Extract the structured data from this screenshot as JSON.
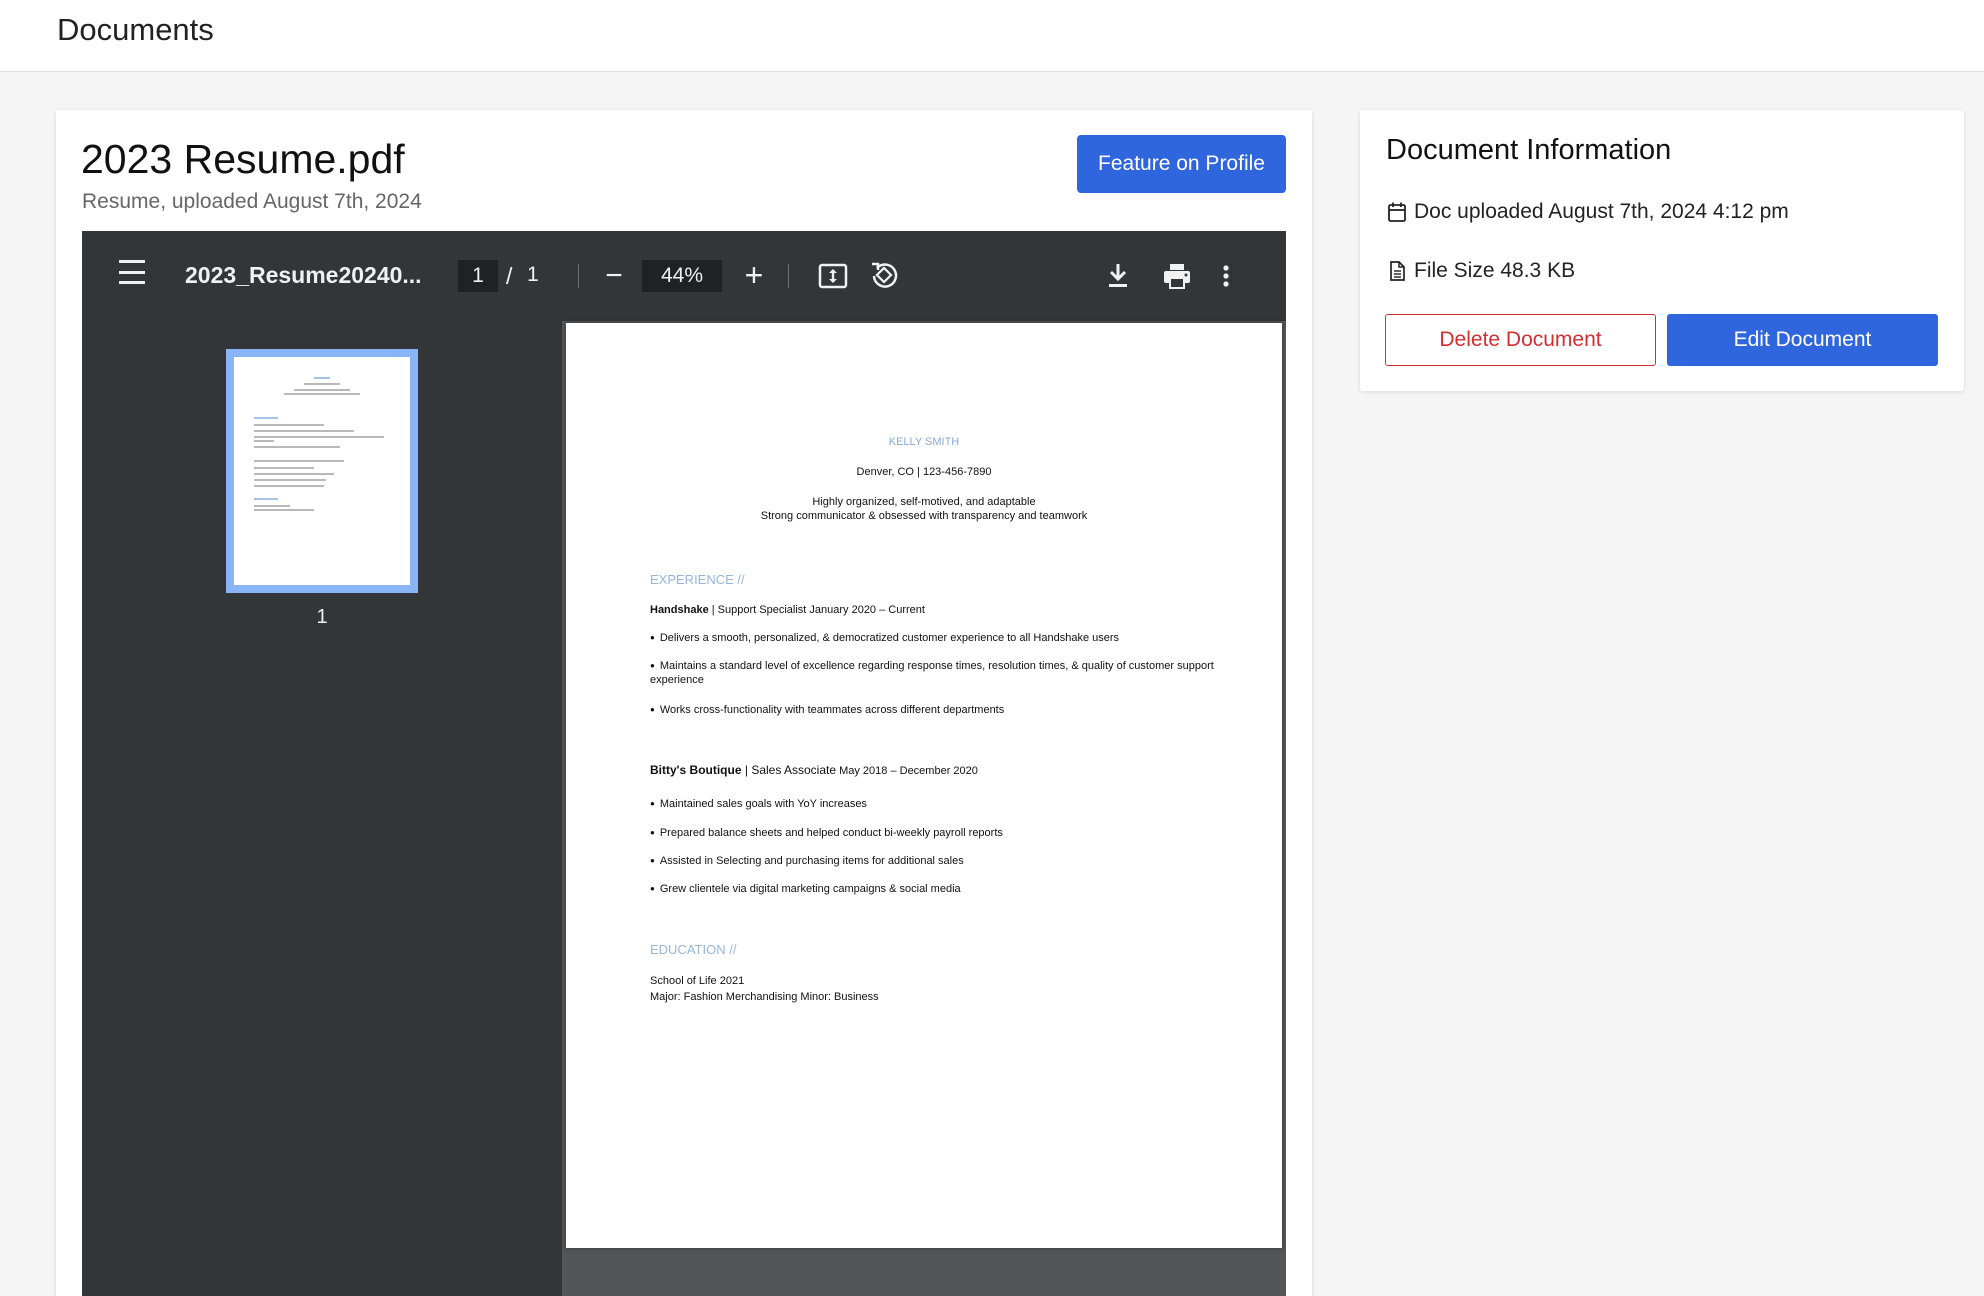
{
  "header": {
    "title": "Documents"
  },
  "document": {
    "title": "2023 Resume.pdf",
    "subtitle": "Resume, uploaded August 7th, 2024",
    "feature_label": "Feature on Profile"
  },
  "viewer": {
    "filename": "2023_Resume20240...",
    "current_page": "1",
    "page_separator": "/",
    "total_pages": "1",
    "zoom": "44%",
    "zoom_out": "−",
    "zoom_in": "+",
    "thumbnail_label": "1",
    "icons": [
      "menu-icon",
      "zoom-out-icon",
      "zoom-in-icon",
      "fit-page-icon",
      "rotate-icon",
      "download-icon",
      "print-icon",
      "more-options-icon"
    ]
  },
  "resume": {
    "name": "KELLY SMITH",
    "contact": "Denver, CO | 123-456-7890",
    "summary_1": "Highly organized, self-motived, and adaptable",
    "summary_2": "Strong communicator & obsessed with transparency and teamwork",
    "experience_heading": "EXPERIENCE //",
    "job1_company": "Handshake",
    "job1_role": " | Support Specialist January 2020 – Current",
    "job1_bullets": [
      "Delivers a smooth, personalized, & democratized customer experience to all Handshake users",
      "Maintains a standard level of excellence regarding response times, resolution times, & quality of customer support",
      "experience",
      "Works cross-functionality with teammates across different departments"
    ],
    "job2_company": "Bitty's Boutique",
    "job2_role": " | Sales Associate",
    "job2_dates": " May 2018 – December 2020",
    "job2_bullets": [
      "Maintained sales goals with YoY increases",
      "Prepared balance sheets and helped conduct bi-weekly payroll reports",
      "Assisted in Selecting and purchasing items for additional sales",
      "Grew clientele via digital marketing campaigns & social media"
    ],
    "education_heading": "EDUCATION //",
    "education_school": "School of Life 2021",
    "education_major": "Major: Fashion Merchandising Minor: Business"
  },
  "info": {
    "title": "Document Information",
    "uploaded": "Doc uploaded August 7th, 2024 4:12 pm",
    "file_size": "File Size 48.3 KB",
    "delete_label": "Delete Document",
    "edit_label": "Edit Document",
    "icons": [
      "calendar-icon",
      "file-icon"
    ]
  },
  "colors": {
    "primary": "#2f66de",
    "danger": "#d32f2f",
    "viewer_bg": "#323639",
    "thumb_highlight": "#8ab4f8",
    "resume_accent": "#8aa9d4"
  }
}
